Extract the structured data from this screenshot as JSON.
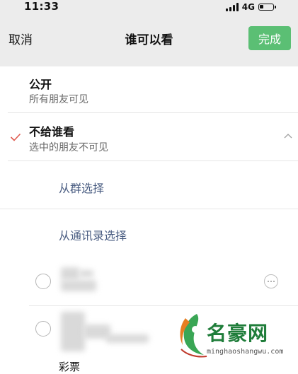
{
  "status_bar": {
    "time": "11:33",
    "network": "4G",
    "battery_level": 0.3
  },
  "nav": {
    "cancel_label": "取消",
    "title": "谁可以看",
    "done_label": "完成",
    "done_color": "#5bbf74"
  },
  "options": [
    {
      "title": "公开",
      "subtitle": "所有朋友可见",
      "selected": false
    },
    {
      "title": "不给谁看",
      "subtitle": "选中的朋友不可见",
      "selected": true
    }
  ],
  "select_links": {
    "from_group": "从群选择",
    "from_contacts": "从通讯录选择"
  },
  "contacts": {
    "partial_name": "彩票"
  },
  "watermark": {
    "name": "名豪网",
    "url": "minghaoshangwu.com"
  },
  "colors": {
    "header_bg": "#ececec",
    "link": "#4a5d82",
    "check": "#e05a4f"
  },
  "icons": [
    "check-icon",
    "chevron-up-icon",
    "more-icon",
    "signal-icon",
    "battery-icon"
  ]
}
